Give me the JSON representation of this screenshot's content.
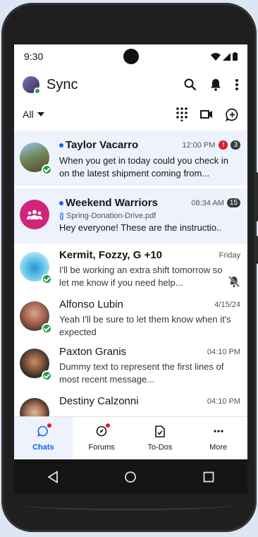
{
  "status": {
    "time": "9:30"
  },
  "header": {
    "title": "Sync"
  },
  "filter": {
    "label": "All"
  },
  "chats": [
    {
      "name": "Taylor Vacarro",
      "time": "12:00 PM",
      "alert": "!",
      "count": "3",
      "message": "When you get in today could you check in on the latest shipment coming from..."
    },
    {
      "name": "Weekend Warriors",
      "time": "08:34 AM",
      "count": "15",
      "attachment": "Spring-Donation-Drive.pdf",
      "message": "Hey everyone! These are the instructio.."
    },
    {
      "name": "Kermit, Fozzy, G +10",
      "time": "Friday",
      "message": "I'll be working an extra shift tomorrow so let me know if you need help..."
    },
    {
      "name": "Alfonso Lubin",
      "time": "4/15/24",
      "message": "Yeah I'll be sure to let them know when it's expected"
    },
    {
      "name": "Paxton Granis",
      "time": "04:10 PM",
      "message": "Dummy text to represent the first lines of most recent message..."
    },
    {
      "name": "Destiny Calzonni",
      "time": "04:10 PM",
      "message": ""
    }
  ],
  "tabs": [
    {
      "label": "Chats"
    },
    {
      "label": "Forums"
    },
    {
      "label": "To-Dos"
    },
    {
      "label": "More"
    }
  ],
  "colors": {
    "accent": "#0f62fe",
    "online": "#24a148",
    "alert": "#da1e28",
    "group": "#d0257b"
  }
}
